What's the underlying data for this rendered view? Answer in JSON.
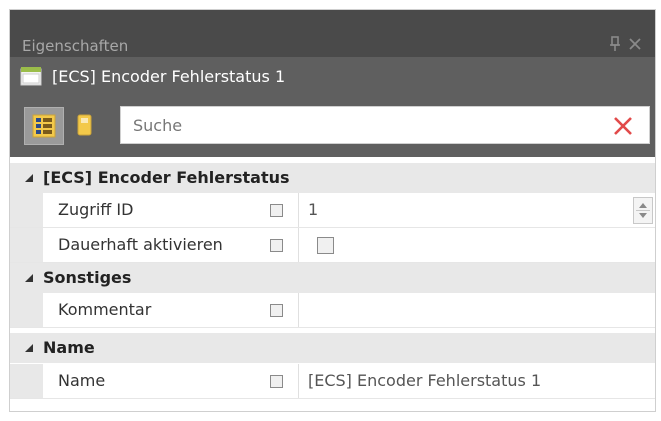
{
  "window": {
    "title": "Eigenschaften",
    "pin_icon": "pin-icon",
    "close_icon": "close-icon"
  },
  "object": {
    "icon": "object-icon",
    "label": "[ECS] Encoder Fehlerstatus 1"
  },
  "toolbar": {
    "categorized_icon": "categorized-view-icon",
    "alphabetical_icon": "alphabetical-view-icon",
    "search": {
      "placeholder": "Suche",
      "value": "",
      "clear_icon": "clear-search-icon",
      "clear_color": "#e24a4a"
    }
  },
  "categories": [
    {
      "label": "[ECS] Encoder Fehlerstatus",
      "properties": [
        {
          "name": "Zugriff ID",
          "value": "1",
          "editor": "spinner"
        },
        {
          "name": "Dauerhaft aktivieren",
          "value": "",
          "editor": "checkbox"
        }
      ]
    },
    {
      "label": "Sonstiges",
      "properties": [
        {
          "name": "Kommentar",
          "value": "",
          "editor": "text"
        }
      ]
    },
    {
      "label": "Name",
      "properties": [
        {
          "name": "Name",
          "value": "[ECS] Encoder Fehlerstatus 1",
          "editor": "text"
        }
      ]
    }
  ]
}
